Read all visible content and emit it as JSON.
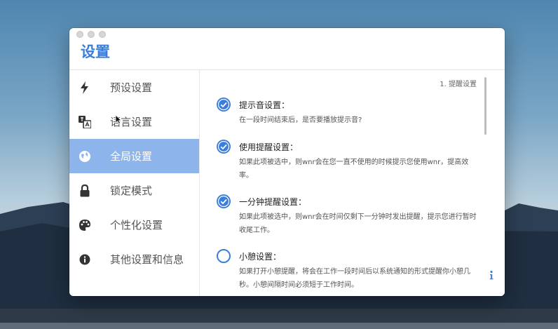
{
  "window": {
    "title": "设置"
  },
  "sidebar": {
    "items": [
      {
        "label": "预设设置",
        "icon": "lightning-icon",
        "active": false
      },
      {
        "label": "语言设置",
        "icon": "translate-icon",
        "active": false
      },
      {
        "label": "全局设置",
        "icon": "globe-icon",
        "active": true
      },
      {
        "label": "锁定模式",
        "icon": "lock-icon",
        "active": false
      },
      {
        "label": "个性化设置",
        "icon": "palette-icon",
        "active": false
      },
      {
        "label": "其他设置和信息",
        "icon": "info-circle-icon",
        "active": false
      }
    ]
  },
  "content": {
    "page_indicator": "1. 提醒设置",
    "options": [
      {
        "title": "提示音设置：",
        "description": "在一段时间结束后，是否要播放提示音?",
        "checked": true
      },
      {
        "title": "使用提醒设置：",
        "description": "如果此项被选中，则wnr会在您一直不使用的时候提示您使用wnr，提高效率。",
        "checked": true
      },
      {
        "title": "一分钟提醒设置：",
        "description": "如果此项被选中，则wnr会在时间仅剩下一分钟时发出提醒，提示您进行暂时收尾工作。",
        "checked": true
      },
      {
        "title": "小憩设置：",
        "description": "如果打开小憩提醒，将会在工作一段时间后以系统通知的形式提醒你小憩几秒。小憩间隔时间必须短于工作时间。",
        "checked": false
      }
    ]
  },
  "colors": {
    "accent": "#3b7ddd",
    "sidebar_active": "#8db5ec"
  }
}
